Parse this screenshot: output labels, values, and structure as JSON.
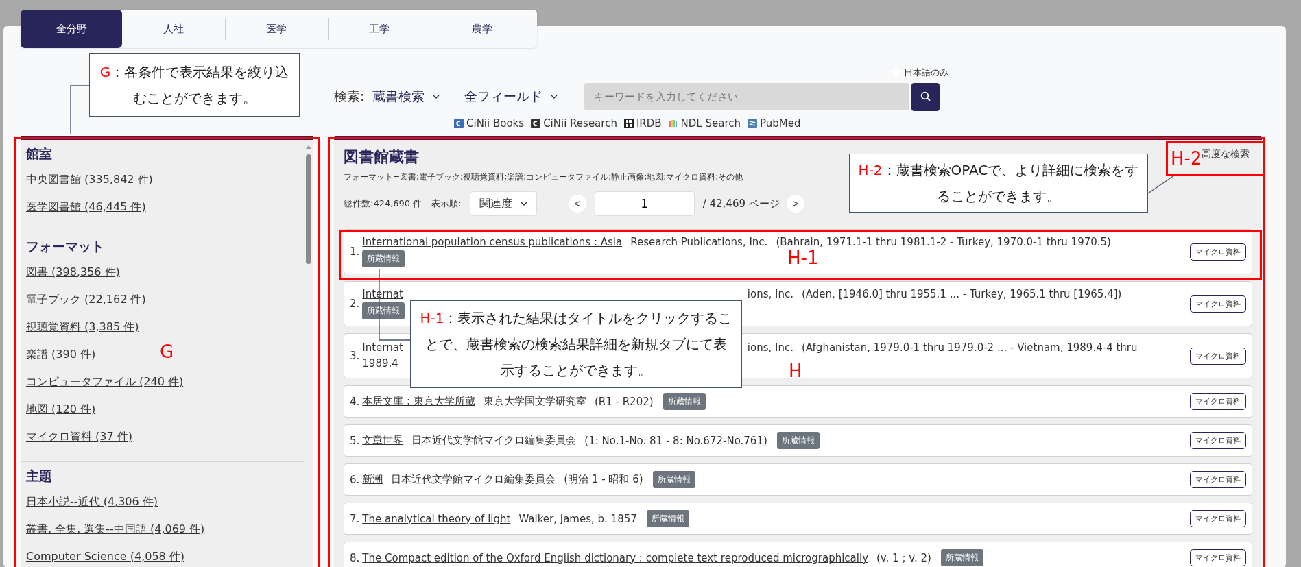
{
  "tabs": [
    {
      "label": "全分野",
      "selected": true
    },
    {
      "label": "人社",
      "selected": false
    },
    {
      "label": "医学",
      "selected": false
    },
    {
      "label": "工学",
      "selected": false
    },
    {
      "label": "農学",
      "selected": false
    }
  ],
  "search": {
    "label": "検索:",
    "scope": "蔵書検索",
    "field": "全フィールド",
    "placeholder": "キーワードを入力してください",
    "japanese_only": {
      "label": "日本語のみ",
      "checked": false
    }
  },
  "external_links": [
    {
      "label": "CiNii Books",
      "kind": "cinii"
    },
    {
      "label": "CiNii Research",
      "kind": "cinii_research"
    },
    {
      "label": "IRDB",
      "kind": "irdb"
    },
    {
      "label": "NDL Search",
      "kind": "ndl"
    },
    {
      "label": "PubMed",
      "kind": "pubmed"
    }
  ],
  "sidebar": {
    "sections": [
      {
        "heading": "館室",
        "items": [
          "中央図書館 (335,842 件)",
          "医学図書館 (46,445 件)"
        ]
      },
      {
        "heading": "フォーマット",
        "items": [
          "図書 (398,356 件)",
          "電子ブック (22,162 件)",
          "視聴覚資料 (3,385 件)",
          "楽譜 (390 件)",
          "コンピュータファイル (240 件)",
          "地図 (120 件)",
          "マイクロ資料 (37 件)"
        ]
      },
      {
        "heading": "主題",
        "items": [
          "日本小説--近代 (4,306 件)",
          "叢書. 全集. 選集--中国語 (4,069 件)",
          "Computer Science (4,058 件)"
        ]
      }
    ]
  },
  "results": {
    "title": "図書館蔵書",
    "format_filter": "フォーマット=図書;電子ブック;視聴覚資料;楽譜;コンピュータファイル;静止画像;地図;マイクロ資料;その他",
    "total": "総件数:424,690 件",
    "sort_label": "表示順:",
    "sort": "関連度",
    "prev": "<",
    "page": "1",
    "page_total": "/ 42,469 ページ",
    "next": ">",
    "advanced_search": "高度な検索",
    "items": [
      {
        "kind": "stacked",
        "number": "1.",
        "title": "International population census publications : Asia",
        "author": "Research Publications, Inc.",
        "holdings": "(Bahrain, 1971.1-1 thru 1981.1-2 - Turkey, 1970.0-1 thru 1970.5)",
        "badge": "所蔵情報",
        "format": "マイクロ資料"
      },
      {
        "kind": "stacked",
        "covered": true,
        "number": "2.",
        "title": "Internat",
        "author": "ions, Inc.",
        "holdings": "(Aden, [1946.0] thru 1955.1 ... - Turkey, 1965.1 thru [1965.4])",
        "badge": "所蔵情報",
        "format": "マイクロ資料"
      },
      {
        "kind": "stacked",
        "covered": true,
        "number": "3.",
        "title": "Internat",
        "author": "ions, Inc.",
        "holdings": "(Afghanistan, 1979.0-1 thru 1979.0-2 ... - Vietnam, 1989.4-4 thru",
        "continued": "1989.4",
        "format": "マイクロ資料"
      },
      {
        "kind": "inline",
        "number": "4.",
        "title": "本居文庫 : 東京大学所蔵",
        "author": "東京大学国文学研究室",
        "holdings": "(R1 - R202)",
        "badge": "所蔵情報",
        "format": "マイクロ資料"
      },
      {
        "kind": "inline",
        "number": "5.",
        "title": "文章世界",
        "author": "日本近代文学館マイクロ編集委員会",
        "holdings": "(1: No.1-No. 81 - 8: No.672-No.761)",
        "badge": "所蔵情報",
        "format": "マイクロ資料"
      },
      {
        "kind": "inline",
        "number": "6.",
        "title": "新潮",
        "author": "日本近代文学館マイクロ編集委員会",
        "holdings": "(明治 1 - 昭和 6)",
        "badge": "所蔵情報",
        "format": "マイクロ資料"
      },
      {
        "kind": "inline",
        "number": "7.",
        "title": "The analytical theory of light",
        "author": "Walker, James, b. 1857",
        "badge": "所蔵情報",
        "format": "マイクロ資料"
      },
      {
        "kind": "inline",
        "number": "8.",
        "title": "The Compact edition of the Oxford English dictionary : complete text reproduced micrographically",
        "holdings": "(v. 1 ; v. 2)",
        "badge": "所蔵情報",
        "format": "マイクロ資料"
      }
    ]
  },
  "annotations": {
    "frames": [
      {
        "kind": "sidebar",
        "label": "G"
      },
      {
        "kind": "results",
        "label": "H"
      },
      {
        "kind": "first_result",
        "label": "H-1"
      },
      {
        "kind": "advanced",
        "label": "H-2"
      }
    ],
    "callouts": [
      {
        "kind": "sidebar",
        "tag": "G",
        "text": "：各条件で表示結果を絞り込むことができます。"
      },
      {
        "kind": "advanced",
        "tag": "H-2",
        "text": "：蔵書検索OPACで、より詳細に検索をすることができます。"
      },
      {
        "kind": "first_result",
        "tag": "H-1",
        "text": "：表示された結果はタイトルをクリックすることで、蔵書検索の検索結果詳細を新規タブにて表示することができます。"
      }
    ]
  }
}
